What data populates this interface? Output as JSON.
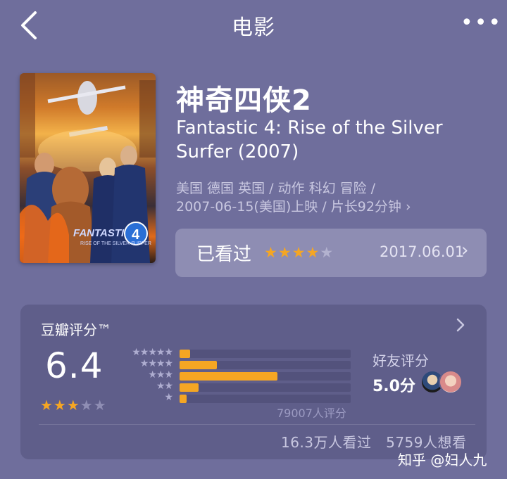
{
  "nav": {
    "title": "电影",
    "more": "•••"
  },
  "movie": {
    "title_cn": "神奇四侠2",
    "title_en": "Fantastic 4: Rise of the Silver Surfer (2007)",
    "meta_line1": "美国 德国 英国 / 动作 科幻 冒险 /",
    "meta_line2": "2007-06-15(美国)上映 / 片长92分钟 ›",
    "poster_caption": "FANTASTIC 4 RISE OF THE SILVER SURFER"
  },
  "watched": {
    "label": "已看过",
    "stars": "★★★★",
    "stars_empty": "★",
    "user_rating": 4,
    "date": "2017.06.01",
    "chevron": "›"
  },
  "douban": {
    "title": "豆瓣评分™",
    "score": "6.4",
    "stars": "★★★",
    "stars_empty": "★★",
    "distribution": [
      {
        "label": "★★★★★",
        "fraction": 0.06
      },
      {
        "label": "★★★★",
        "fraction": 0.22
      },
      {
        "label": "★★★",
        "fraction": 0.57
      },
      {
        "label": "★★",
        "fraction": 0.11
      },
      {
        "label": "★",
        "fraction": 0.04
      }
    ],
    "rating_count": "79007人评分",
    "friend_label": "好友评分",
    "friend_score": "5.0分",
    "watched_count": "16.3万人看过",
    "want_count": "5759人想看"
  },
  "watermark": "知乎 @妇人九",
  "colors": {
    "background": "#6f6e9c",
    "star": "#f5a623",
    "card": "#5f5e8a"
  }
}
